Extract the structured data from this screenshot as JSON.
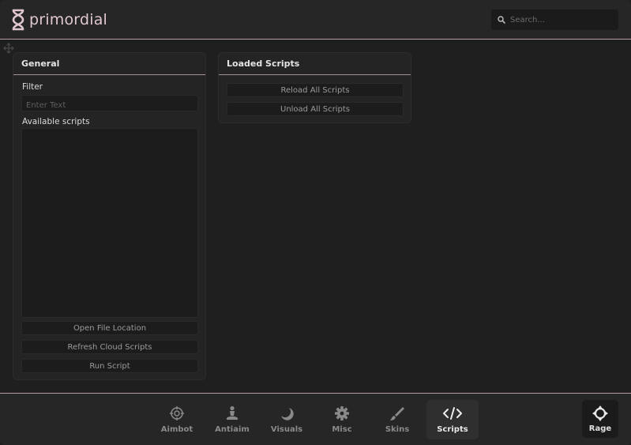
{
  "app": {
    "name": "primordial"
  },
  "search": {
    "placeholder": "Search..."
  },
  "general": {
    "title": "General",
    "filter_label": "Filter",
    "filter_placeholder": "Enter Text",
    "available_label": "Available scripts",
    "buttons": [
      "Open File Location",
      "Refresh Cloud Scripts",
      "Run Script"
    ]
  },
  "loaded": {
    "title": "Loaded Scripts",
    "buttons": [
      "Reload All Scripts",
      "Unload All Scripts"
    ]
  },
  "tabs": [
    {
      "label": "Aimbot",
      "icon": "crosshair-icon"
    },
    {
      "label": "Antiaim",
      "icon": "figure-icon"
    },
    {
      "label": "Visuals",
      "icon": "moon-icon"
    },
    {
      "label": "Misc",
      "icon": "gear-icon"
    },
    {
      "label": "Skins",
      "icon": "brush-icon"
    },
    {
      "label": "Scripts",
      "icon": "code-icon",
      "active": true
    }
  ],
  "mode": {
    "label": "Rage",
    "icon": "target-icon"
  },
  "colors": {
    "accent": "#b89aa4",
    "logo": "#e0c7cf",
    "background": "#1f1f1f"
  }
}
